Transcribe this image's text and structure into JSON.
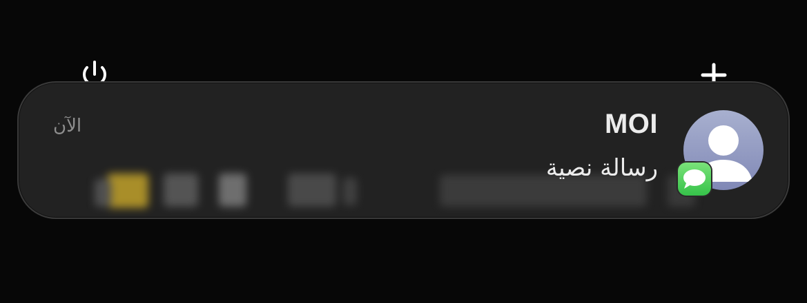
{
  "status_icons": {
    "left": "power-icon",
    "right": "plus-icon"
  },
  "notification": {
    "sender": "MOI",
    "message": "رسالة نصية",
    "timestamp": "الآن",
    "avatar_icon": "person-icon",
    "app_icon": "messages-app-icon",
    "colors": {
      "card_background": "#222222",
      "avatar_top": "#a8b0cf",
      "avatar_bottom": "#8088b6",
      "badge_green": "#36c24a"
    }
  }
}
